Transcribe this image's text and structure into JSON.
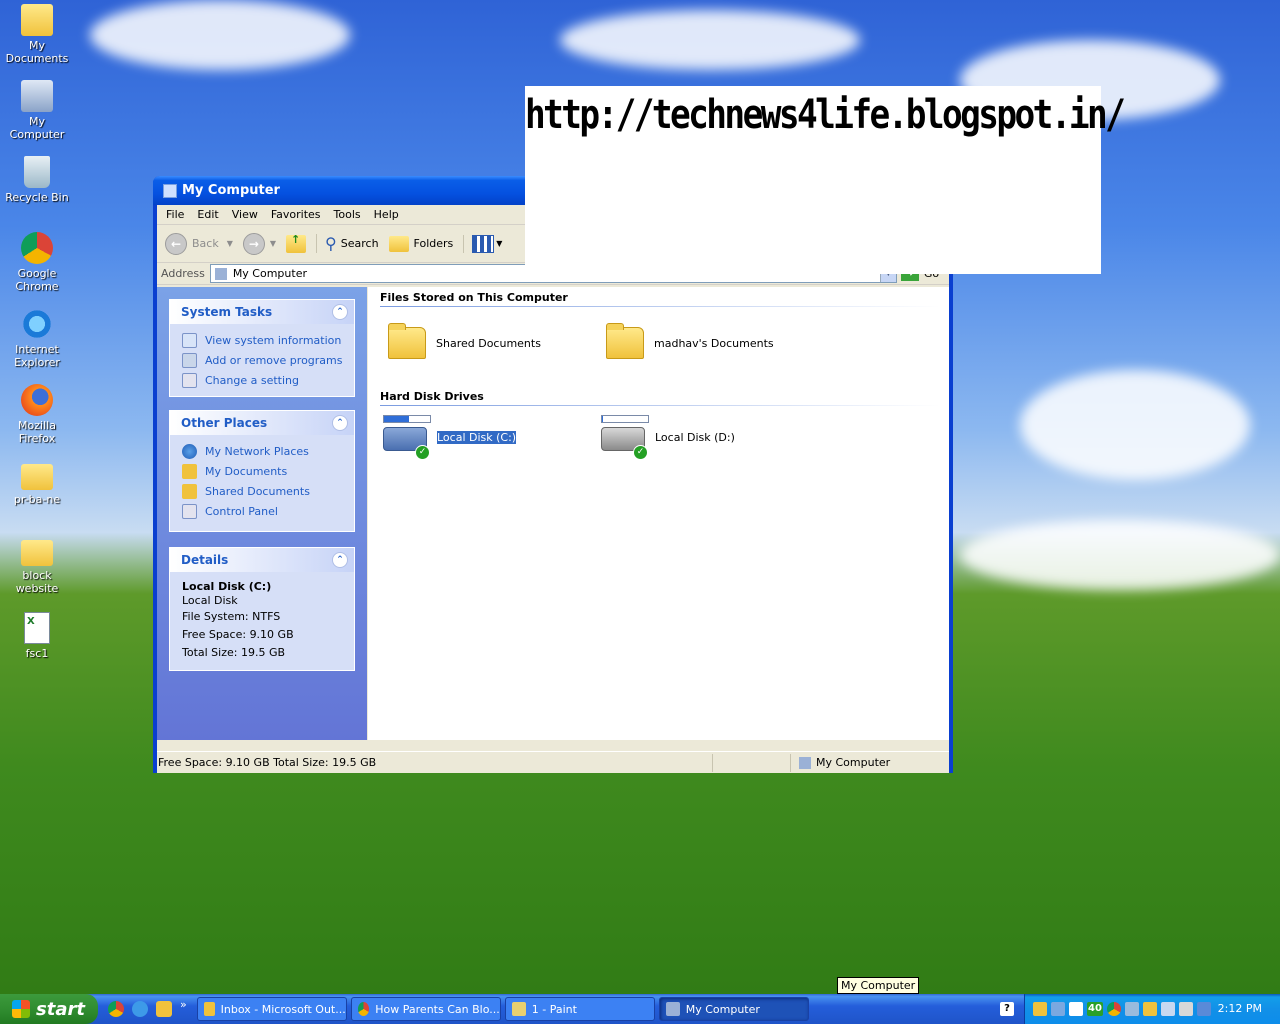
{
  "desktop": {
    "icons": [
      {
        "label": "My Documents"
      },
      {
        "label": "My Computer"
      },
      {
        "label": "Recycle Bin"
      },
      {
        "label": "Google Chrome"
      },
      {
        "label": "Internet Explorer"
      },
      {
        "label": "Mozilla Firefox"
      },
      {
        "label": "pr-ba-ne"
      },
      {
        "label": "block website"
      },
      {
        "label": "fsc1"
      }
    ]
  },
  "banner": {
    "text": "http://technews4life.blogspot.in/"
  },
  "window": {
    "title": "My Computer",
    "menu": [
      "File",
      "Edit",
      "View",
      "Favorites",
      "Tools",
      "Help"
    ],
    "toolbar": {
      "back": "Back",
      "search": "Search",
      "folders": "Folders"
    },
    "address": {
      "label": "Address",
      "value": "My Computer",
      "go": "Go"
    },
    "system_tasks": {
      "title": "System Tasks",
      "items": [
        "View system information",
        "Add or remove programs",
        "Change a setting"
      ]
    },
    "other_places": {
      "title": "Other Places",
      "items": [
        "My Network Places",
        "My Documents",
        "Shared Documents",
        "Control Panel"
      ]
    },
    "details": {
      "title": "Details",
      "name": "Local Disk (C:)",
      "type": "Local Disk",
      "file_system": "File System: NTFS",
      "free_space": "Free Space: 9.10 GB",
      "total_size": "Total Size: 19.5 GB"
    },
    "files_section": {
      "title": "Files Stored on This Computer",
      "items": [
        "Shared Documents",
        "madhav's Documents"
      ]
    },
    "drives_section": {
      "title": "Hard Disk Drives",
      "items": [
        {
          "label": "Local Disk (C:)",
          "used_fraction": 0.55,
          "selected": true
        },
        {
          "label": "Local Disk (D:)",
          "used_fraction": 0.03,
          "selected": false
        }
      ]
    },
    "status": {
      "left": "Free Space: 9.10 GB Total Size: 19.5 GB",
      "right": "My Computer"
    }
  },
  "taskbar": {
    "start": "start",
    "chevron": "»",
    "tasks": [
      {
        "label": "Inbox - Microsoft Out..."
      },
      {
        "label": "How Parents Can Blo..."
      },
      {
        "label": "1 - Paint"
      },
      {
        "label": "My Computer"
      }
    ],
    "tray_badge": "40",
    "clock": "2:12 PM"
  },
  "tooltip": "My Computer",
  "colors": {
    "title_blue": "#0551e0",
    "link_blue": "#215dc6",
    "taskbar_blue": "#245edb",
    "start_green": "#2e8a2e"
  }
}
